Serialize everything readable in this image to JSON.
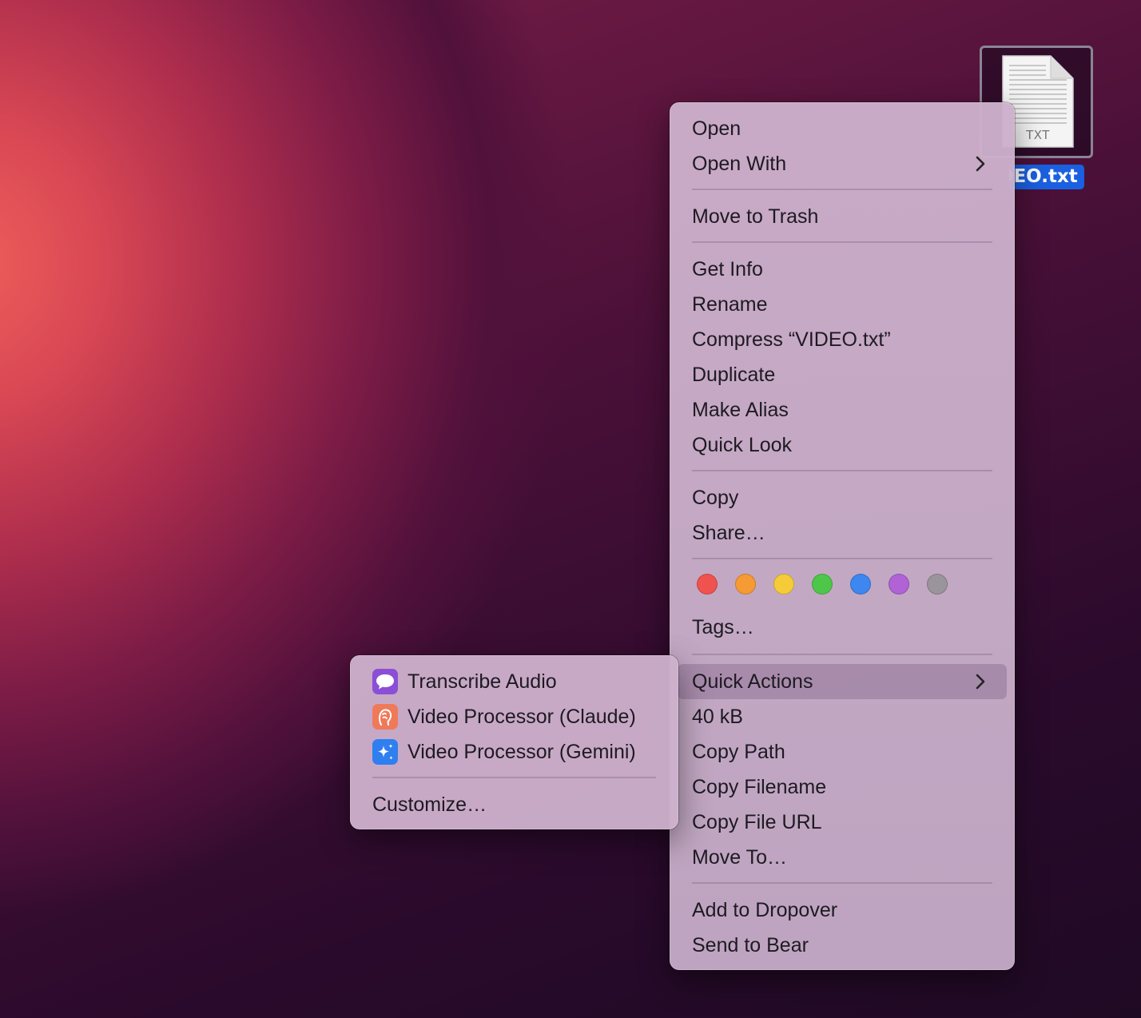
{
  "desktop": {
    "file": {
      "type_label": "TXT",
      "name": "VIDEO.txt"
    }
  },
  "context_menu": {
    "groups": [
      [
        {
          "label": "Open"
        },
        {
          "label": "Open With",
          "has_submenu": true
        }
      ],
      [
        {
          "label": "Move to Trash"
        }
      ],
      [
        {
          "label": "Get Info"
        },
        {
          "label": "Rename"
        },
        {
          "label": "Compress “VIDEO.txt”"
        },
        {
          "label": "Duplicate"
        },
        {
          "label": "Make Alias"
        },
        {
          "label": "Quick Look"
        }
      ],
      [
        {
          "label": "Copy"
        },
        {
          "label": "Share…"
        }
      ],
      [
        {
          "label": "Tags…"
        }
      ],
      [
        {
          "label": "Quick Actions",
          "has_submenu": true,
          "highlighted": true
        },
        {
          "label": "40 kB"
        },
        {
          "label": "Copy Path"
        },
        {
          "label": "Copy Filename"
        },
        {
          "label": "Copy File URL"
        },
        {
          "label": "Move To…"
        }
      ],
      [
        {
          "label": "Add to Dropover"
        },
        {
          "label": "Send to Bear"
        }
      ]
    ],
    "tag_colors": [
      {
        "name": "red",
        "color": "#f0524f"
      },
      {
        "name": "orange",
        "color": "#f59a35"
      },
      {
        "name": "yellow",
        "color": "#f6cb3a"
      },
      {
        "name": "green",
        "color": "#4ec64a"
      },
      {
        "name": "blue",
        "color": "#3e86f0"
      },
      {
        "name": "purple",
        "color": "#b062d6"
      },
      {
        "name": "gray",
        "color": "#9a949b"
      }
    ]
  },
  "quick_actions_submenu": {
    "items": [
      {
        "label": "Transcribe Audio",
        "icon": "speech-bubble-icon",
        "icon_color": "#8a4fd6"
      },
      {
        "label": "Video Processor (Claude)",
        "icon": "claude-icon",
        "icon_color": "#ef7a5a"
      },
      {
        "label": "Video Processor (Gemini)",
        "icon": "sparkle-icon",
        "icon_color": "#2f7ff0"
      }
    ],
    "customize_label": "Customize…"
  }
}
